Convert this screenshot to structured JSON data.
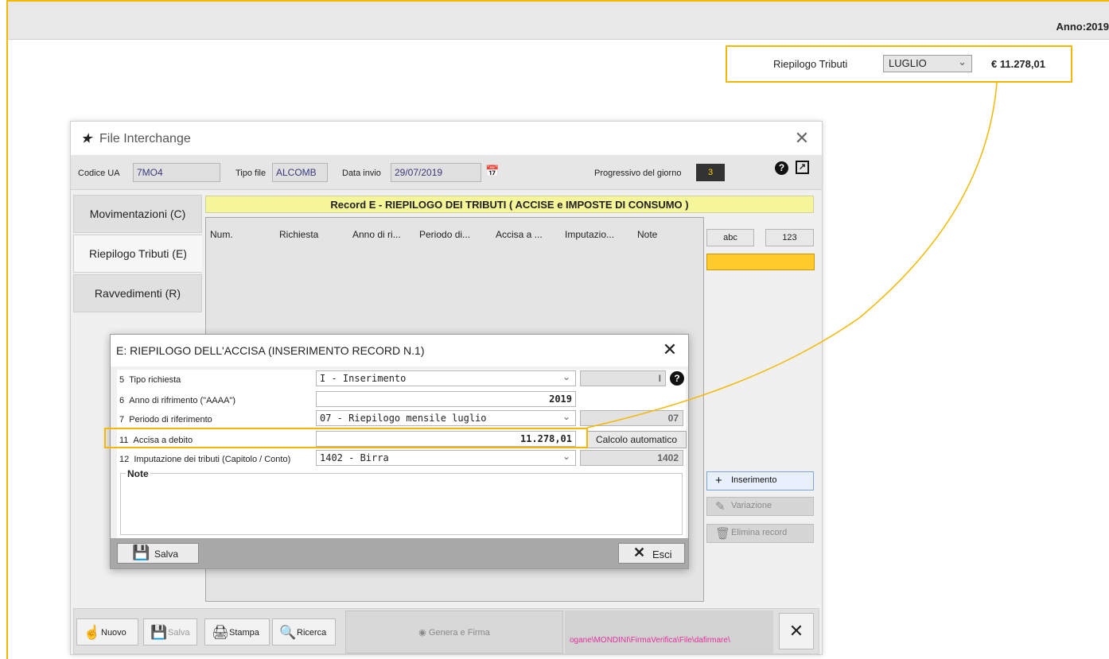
{
  "page": {
    "anno_label": "Anno:2019",
    "riepilogo": {
      "label": "Riepilogo Tributi",
      "month": "LUGLIO",
      "amount": "€ 11.278,01"
    }
  },
  "file_interchange": {
    "title": "File Interchange",
    "codice_ua": {
      "label": "Codice UA",
      "value": "7MO4"
    },
    "tipo_file": {
      "label": "Tipo file",
      "value": "ALCOMB"
    },
    "data_invio": {
      "label": "Data invio",
      "value": "29/07/2019"
    },
    "progressivo": {
      "label": "Progressivo del giorno",
      "value": "3"
    },
    "tabs": [
      {
        "label": "Movimentazioni (C)"
      },
      {
        "label": "Riepilogo Tributi (E)"
      },
      {
        "label": "Ravvedimenti (R)"
      }
    ],
    "record_header": "Record E  -  RIEPILOGO DEI TRIBUTI  ( ACCISE e IMPOSTE DI CONSUMO )",
    "columns": [
      "Num.",
      "Richiesta",
      "Anno di ri...",
      "Periodo di...",
      "Accisa a ...",
      "Imputazio...",
      "Note"
    ],
    "side_buttons": {
      "abc": "abc",
      "num": "123",
      "inserimento": "Inserimento",
      "variazione": "Variazione",
      "elimina": "Elimina record"
    },
    "toolbar": {
      "nuovo": "Nuovo",
      "salva": "Salva",
      "stampa": "Stampa",
      "ricerca": "Ricerca",
      "genera": "Genera e Firma",
      "path": "ogane\\MONDINI\\FirmaVerifica\\File\\dafirmare\\"
    }
  },
  "dialog": {
    "title": "E: RIEPILOGO DELL'ACCISA (INSERIMENTO RECORD N.1)",
    "rows": [
      {
        "num": "5",
        "label": "Tipo richiesta",
        "value": "I - Inserimento",
        "code": "I"
      },
      {
        "num": "6",
        "label": "Anno di rifrimento (\"AAAA\")",
        "value": "2019"
      },
      {
        "num": "7",
        "label": "Periodo di riferimento",
        "value": "07 - Riepilogo mensile luglio",
        "code": "07"
      },
      {
        "num": "11",
        "label": "Accisa a debito",
        "value": "11.278,01",
        "action": "Calcolo automatico"
      },
      {
        "num": "12",
        "label": "Imputazione dei tributi (Capitolo / Conto)",
        "value": "1402 - Birra",
        "code": "1402"
      }
    ],
    "note_label": "Note",
    "salva": "Salva",
    "esci": "Esci"
  },
  "colors": {
    "highlight": "#f5b800",
    "record_header_bg": "#f5f59a",
    "progressivo_text": "#ffd400",
    "path_text": "#e0319c"
  }
}
